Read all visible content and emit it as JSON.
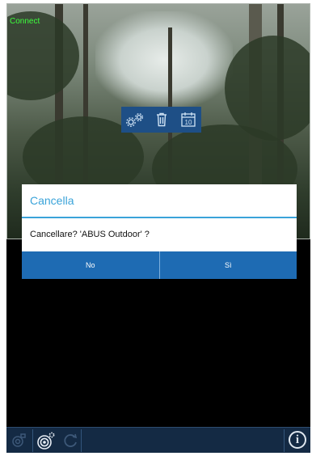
{
  "camera": {
    "status_text": "Connect",
    "toolbar": {
      "icons": [
        "settings-icon",
        "trash-icon",
        "calendar-icon"
      ],
      "calendar_day": "10"
    }
  },
  "dialog": {
    "title": "Cancella",
    "message": "Cancellare? 'ABUS Outdoor' ?",
    "buttons": {
      "no": "No",
      "yes": "Sì"
    },
    "accent_color": "#3aa3d9",
    "button_color": "#1e6bb3"
  },
  "bottom_bar": {
    "icons": [
      "camera-icon",
      "record-icon",
      "refresh-icon",
      "info-icon"
    ],
    "info_label": "i"
  }
}
